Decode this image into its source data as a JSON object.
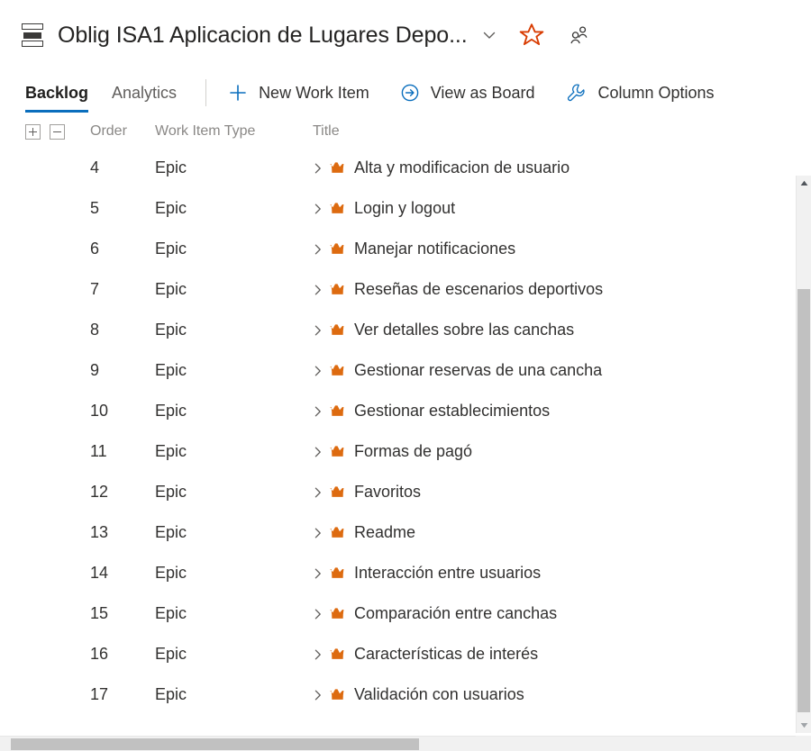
{
  "header": {
    "backlog_icon": "backlog-list-icon",
    "title": "Oblig ISA1 Aplicacion de Lugares Depo...",
    "chevron_icon": "chevron-down-icon",
    "favorite_icon": "star-icon",
    "favorite_color": "#d83b01",
    "team_icon": "people-icon"
  },
  "toolbar": {
    "tabs": [
      {
        "label": "Backlog",
        "selected": true
      },
      {
        "label": "Analytics",
        "selected": false
      }
    ],
    "active_tab_underline_color": "#0a6ebd",
    "actions": [
      {
        "label": "New Work Item",
        "icon": "plus-icon",
        "color": "#0a6ebd"
      },
      {
        "label": "View as Board",
        "icon": "arrow-circle-right-icon",
        "color": "#0a6ebd"
      },
      {
        "label": "Column Options",
        "icon": "wrench-icon",
        "color": "#0a6ebd"
      }
    ]
  },
  "grid": {
    "expand_all_label": "+",
    "collapse_all_label": "−",
    "columns": {
      "order": "Order",
      "work_item_type": "Work Item Type",
      "title": "Title"
    },
    "row_expander_icon": "chevron-right-icon",
    "work_item_icon": "crown-icon",
    "work_item_icon_color": "#dd6b10",
    "rows": [
      {
        "order": "4",
        "type": "Epic",
        "title": "Alta y modificacion de usuario"
      },
      {
        "order": "5",
        "type": "Epic",
        "title": "Login y logout"
      },
      {
        "order": "6",
        "type": "Epic",
        "title": "Manejar notificaciones"
      },
      {
        "order": "7",
        "type": "Epic",
        "title": "Reseñas de escenarios deportivos"
      },
      {
        "order": "8",
        "type": "Epic",
        "title": "Ver detalles sobre las canchas"
      },
      {
        "order": "9",
        "type": "Epic",
        "title": "Gestionar reservas de una cancha"
      },
      {
        "order": "10",
        "type": "Epic",
        "title": "Gestionar establecimientos"
      },
      {
        "order": "11",
        "type": "Epic",
        "title": "Formas de pagó"
      },
      {
        "order": "12",
        "type": "Epic",
        "title": "Favoritos"
      },
      {
        "order": "13",
        "type": "Epic",
        "title": "Readme"
      },
      {
        "order": "14",
        "type": "Epic",
        "title": "Interacción entre usuarios"
      },
      {
        "order": "15",
        "type": "Epic",
        "title": "Comparación entre canchas"
      },
      {
        "order": "16",
        "type": "Epic",
        "title": "Características de interés"
      },
      {
        "order": "17",
        "type": "Epic",
        "title": "Validación con usuarios"
      }
    ]
  },
  "scrollbars": {
    "vertical_up_icon": "triangle-up-icon",
    "vertical_down_icon": "triangle-down-icon",
    "thumb_color": "#c1c1c1",
    "track_color": "#f1f1f1"
  }
}
